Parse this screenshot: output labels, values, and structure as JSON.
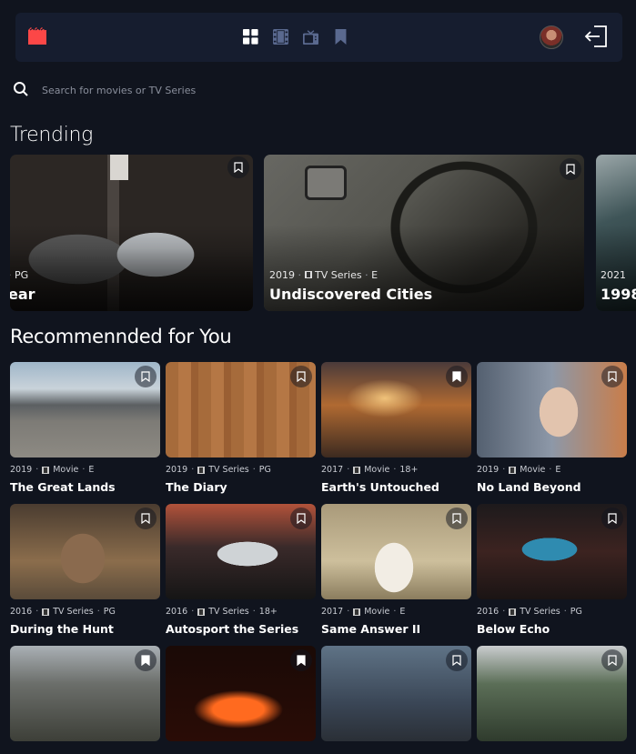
{
  "nav": {
    "logo": "movie-clapper-icon",
    "items": [
      {
        "name": "home",
        "icon": "grid-icon",
        "active": true
      },
      {
        "name": "movies",
        "icon": "film-icon",
        "active": false
      },
      {
        "name": "tv",
        "icon": "tv-icon",
        "active": false
      },
      {
        "name": "bookmarks",
        "icon": "bookmark-icon",
        "active": false
      }
    ]
  },
  "colors": {
    "accent": "#FC4747",
    "bg": "#10141E",
    "nav_bg": "#161D2F",
    "muted_icon": "#5A698F"
  },
  "search": {
    "placeholder": "Search for movies or TV Series"
  },
  "trending": {
    "title": "Trending",
    "items": [
      {
        "year": "",
        "category": "",
        "rating": "PG",
        "title": "ear"
      },
      {
        "year": "2019",
        "category": "TV Series",
        "rating": "E",
        "title": "Undiscovered Cities"
      },
      {
        "year": "2021",
        "category": "",
        "rating": "",
        "title": "1998"
      }
    ]
  },
  "recommended": {
    "title": "Recommennded for You",
    "items": [
      {
        "year": "2019",
        "category": "Movie",
        "rating": "E",
        "title": "The Great Lands",
        "bookmarked": false
      },
      {
        "year": "2019",
        "category": "TV Series",
        "rating": "PG",
        "title": "The Diary",
        "bookmarked": false
      },
      {
        "year": "2017",
        "category": "Movie",
        "rating": "18+",
        "title": "Earth's Untouched",
        "bookmarked": true
      },
      {
        "year": "2019",
        "category": "Movie",
        "rating": "E",
        "title": "No Land Beyond",
        "bookmarked": false
      },
      {
        "year": "2016",
        "category": "TV Series",
        "rating": "PG",
        "title": "During the Hunt",
        "bookmarked": false
      },
      {
        "year": "2016",
        "category": "TV Series",
        "rating": "18+",
        "title": "Autosport the Series",
        "bookmarked": false
      },
      {
        "year": "2017",
        "category": "Movie",
        "rating": "E",
        "title": "Same Answer II",
        "bookmarked": false
      },
      {
        "year": "2016",
        "category": "TV Series",
        "rating": "PG",
        "title": "Below Echo",
        "bookmarked": false
      },
      {
        "year": "",
        "category": "",
        "rating": "",
        "title": "",
        "bookmarked": true
      },
      {
        "year": "",
        "category": "",
        "rating": "",
        "title": "",
        "bookmarked": true
      },
      {
        "year": "",
        "category": "",
        "rating": "",
        "title": "",
        "bookmarked": false
      },
      {
        "year": "",
        "category": "",
        "rating": "",
        "title": "",
        "bookmarked": false
      }
    ]
  }
}
